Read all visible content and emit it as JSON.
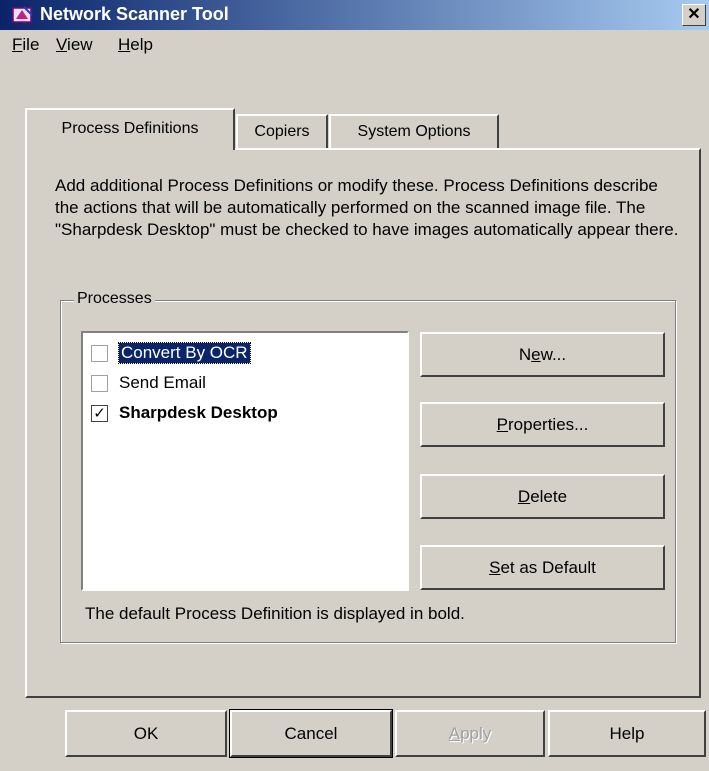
{
  "window": {
    "title": "Network Scanner Tool",
    "close_glyph": "✕"
  },
  "menu": [
    {
      "first": "F",
      "rest": "ile"
    },
    {
      "first": "V",
      "rest": "iew"
    },
    {
      "first": "H",
      "rest": "elp"
    }
  ],
  "tabs": [
    {
      "label": "Process Definitions",
      "active": true
    },
    {
      "label": "Copiers",
      "active": false
    },
    {
      "label": "System Options",
      "active": false
    }
  ],
  "description": "Add additional Process Definitions or modify these. Process Definitions describe the actions that will be automatically performed on the scanned image file. The \"Sharpdesk Desktop\" must be checked to have images automatically appear there.",
  "processes": {
    "group_label": "Processes",
    "items": [
      {
        "label": "Convert By OCR",
        "checked": false,
        "selected": true,
        "default": false
      },
      {
        "label": "Send Email",
        "checked": false,
        "selected": false,
        "default": false
      },
      {
        "label": "Sharpdesk Desktop",
        "checked": true,
        "selected": false,
        "default": true
      }
    ],
    "check_glyph": "✓",
    "footnote": "The default Process Definition is displayed in bold."
  },
  "process_buttons": {
    "new": {
      "pre": "N",
      "ul": "e",
      "post": "w..."
    },
    "properties": {
      "pre": "",
      "ul": "P",
      "post": "roperties..."
    },
    "delete": {
      "pre": "",
      "ul": "D",
      "post": "elete"
    },
    "set_default": {
      "pre": "",
      "ul": "S",
      "post": "et as Default"
    }
  },
  "dialog_buttons": {
    "ok": "OK",
    "cancel": "Cancel",
    "apply": {
      "ul": "A",
      "post": "pply",
      "disabled": true
    },
    "help": "Help"
  },
  "colors": {
    "title_start": "#0a246a",
    "title_end": "#a6caf0",
    "face": "#d4d0c8",
    "selection": "#0a246a"
  }
}
